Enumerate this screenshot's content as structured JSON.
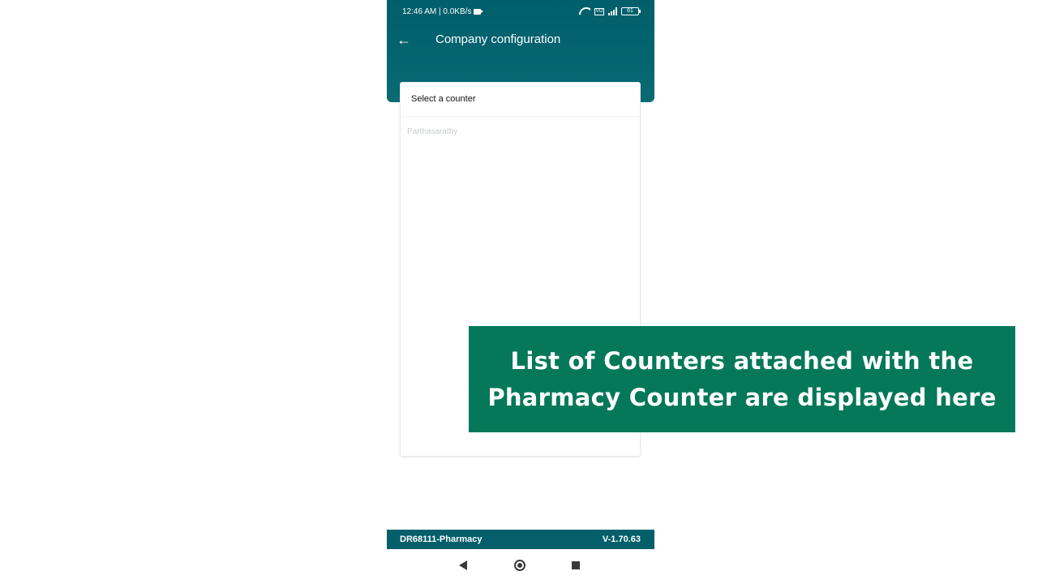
{
  "status_bar": {
    "time_speed": "12:46 AM | 0.0KB/s",
    "vo_label": "VO",
    "battery": "61"
  },
  "header": {
    "title": "Company configuration",
    "color": "#005f6b"
  },
  "counter_sheet": {
    "title": "Select a counter",
    "items": [
      "Parthasarathy"
    ]
  },
  "footer": {
    "company": "DR68111-Pharmacy",
    "version": "V-1.70.63"
  },
  "caption": {
    "line1": "List of Counters attached with the",
    "line2": "Pharmacy Counter are displayed here",
    "color": "#05785a"
  },
  "icons": [
    "back-arrow-icon",
    "wifi-icon",
    "signal-icon",
    "battery-icon",
    "nav-back-icon",
    "nav-home-icon",
    "nav-recent-icon"
  ]
}
